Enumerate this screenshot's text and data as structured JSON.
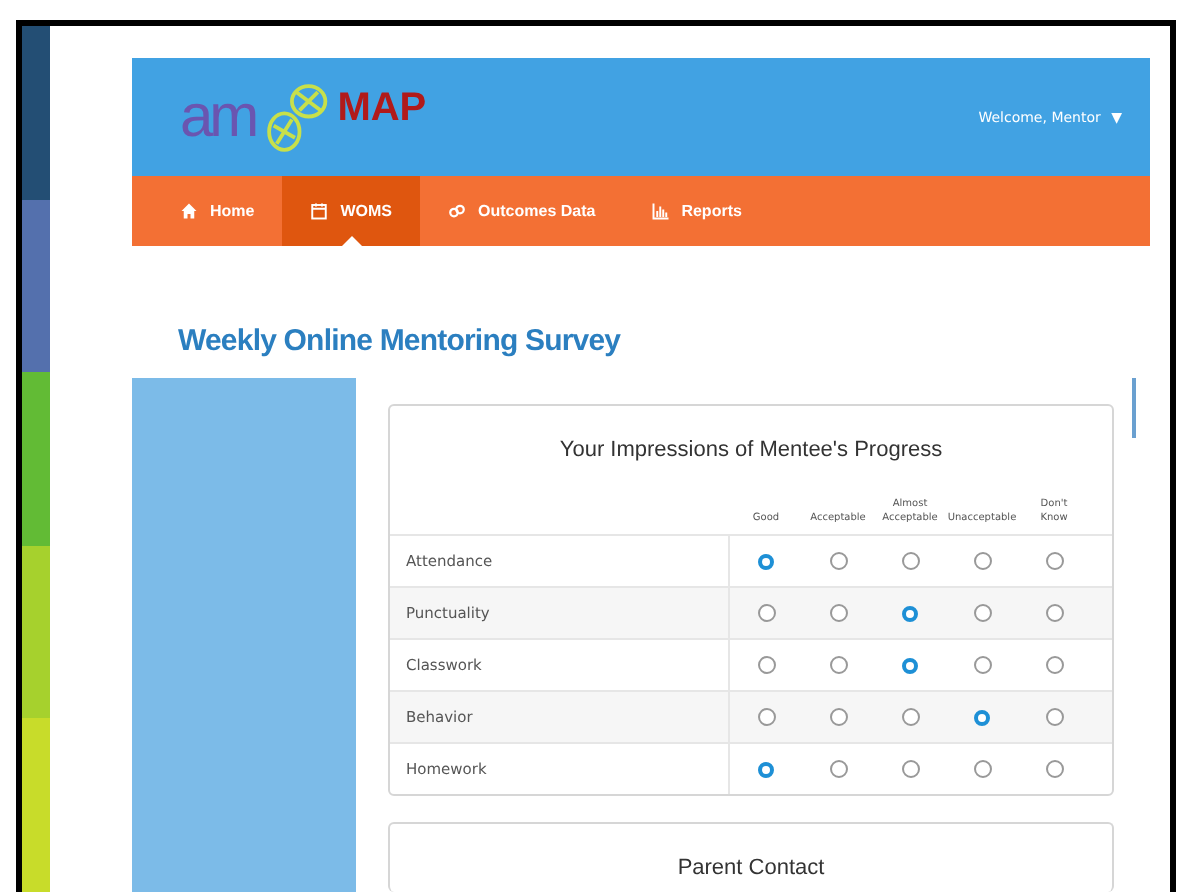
{
  "header": {
    "logo_left": "am",
    "logo_right": "MAP",
    "welcome": "Welcome, Mentor",
    "caret": "▼"
  },
  "nav": [
    {
      "label": "Home",
      "kind": "home",
      "selected": false
    },
    {
      "label": "WOMS",
      "kind": "calendar",
      "selected": true
    },
    {
      "label": "Outcomes Data",
      "kind": "link",
      "selected": false
    },
    {
      "label": "Reports",
      "kind": "chart",
      "selected": false
    }
  ],
  "page_title": "Weekly Online Mentoring Survey",
  "survey": {
    "title": "Your Impressions of Mentee's Progress",
    "columns": [
      [
        "Good"
      ],
      [
        "Acceptable"
      ],
      [
        "Almost",
        "Acceptable"
      ],
      [
        "Unacceptable"
      ],
      [
        "Don't",
        "Know"
      ]
    ],
    "rows": [
      {
        "label": "Attendance",
        "options": [
          {
            "selected": true
          },
          {
            "selected": false
          },
          {
            "selected": false
          },
          {
            "selected": false
          },
          {
            "selected": false
          }
        ]
      },
      {
        "label": "Punctuality",
        "options": [
          {
            "selected": false
          },
          {
            "selected": false
          },
          {
            "selected": true
          },
          {
            "selected": false
          },
          {
            "selected": false
          }
        ]
      },
      {
        "label": "Classwork",
        "options": [
          {
            "selected": false
          },
          {
            "selected": false
          },
          {
            "selected": true
          },
          {
            "selected": false
          },
          {
            "selected": false
          }
        ]
      },
      {
        "label": "Behavior",
        "options": [
          {
            "selected": false
          },
          {
            "selected": false
          },
          {
            "selected": false
          },
          {
            "selected": true
          },
          {
            "selected": false
          }
        ]
      },
      {
        "label": "Homework",
        "options": [
          {
            "selected": true
          },
          {
            "selected": false
          },
          {
            "selected": false
          },
          {
            "selected": false
          },
          {
            "selected": false
          }
        ]
      }
    ]
  },
  "parent_contact": {
    "title": "Parent Contact"
  }
}
